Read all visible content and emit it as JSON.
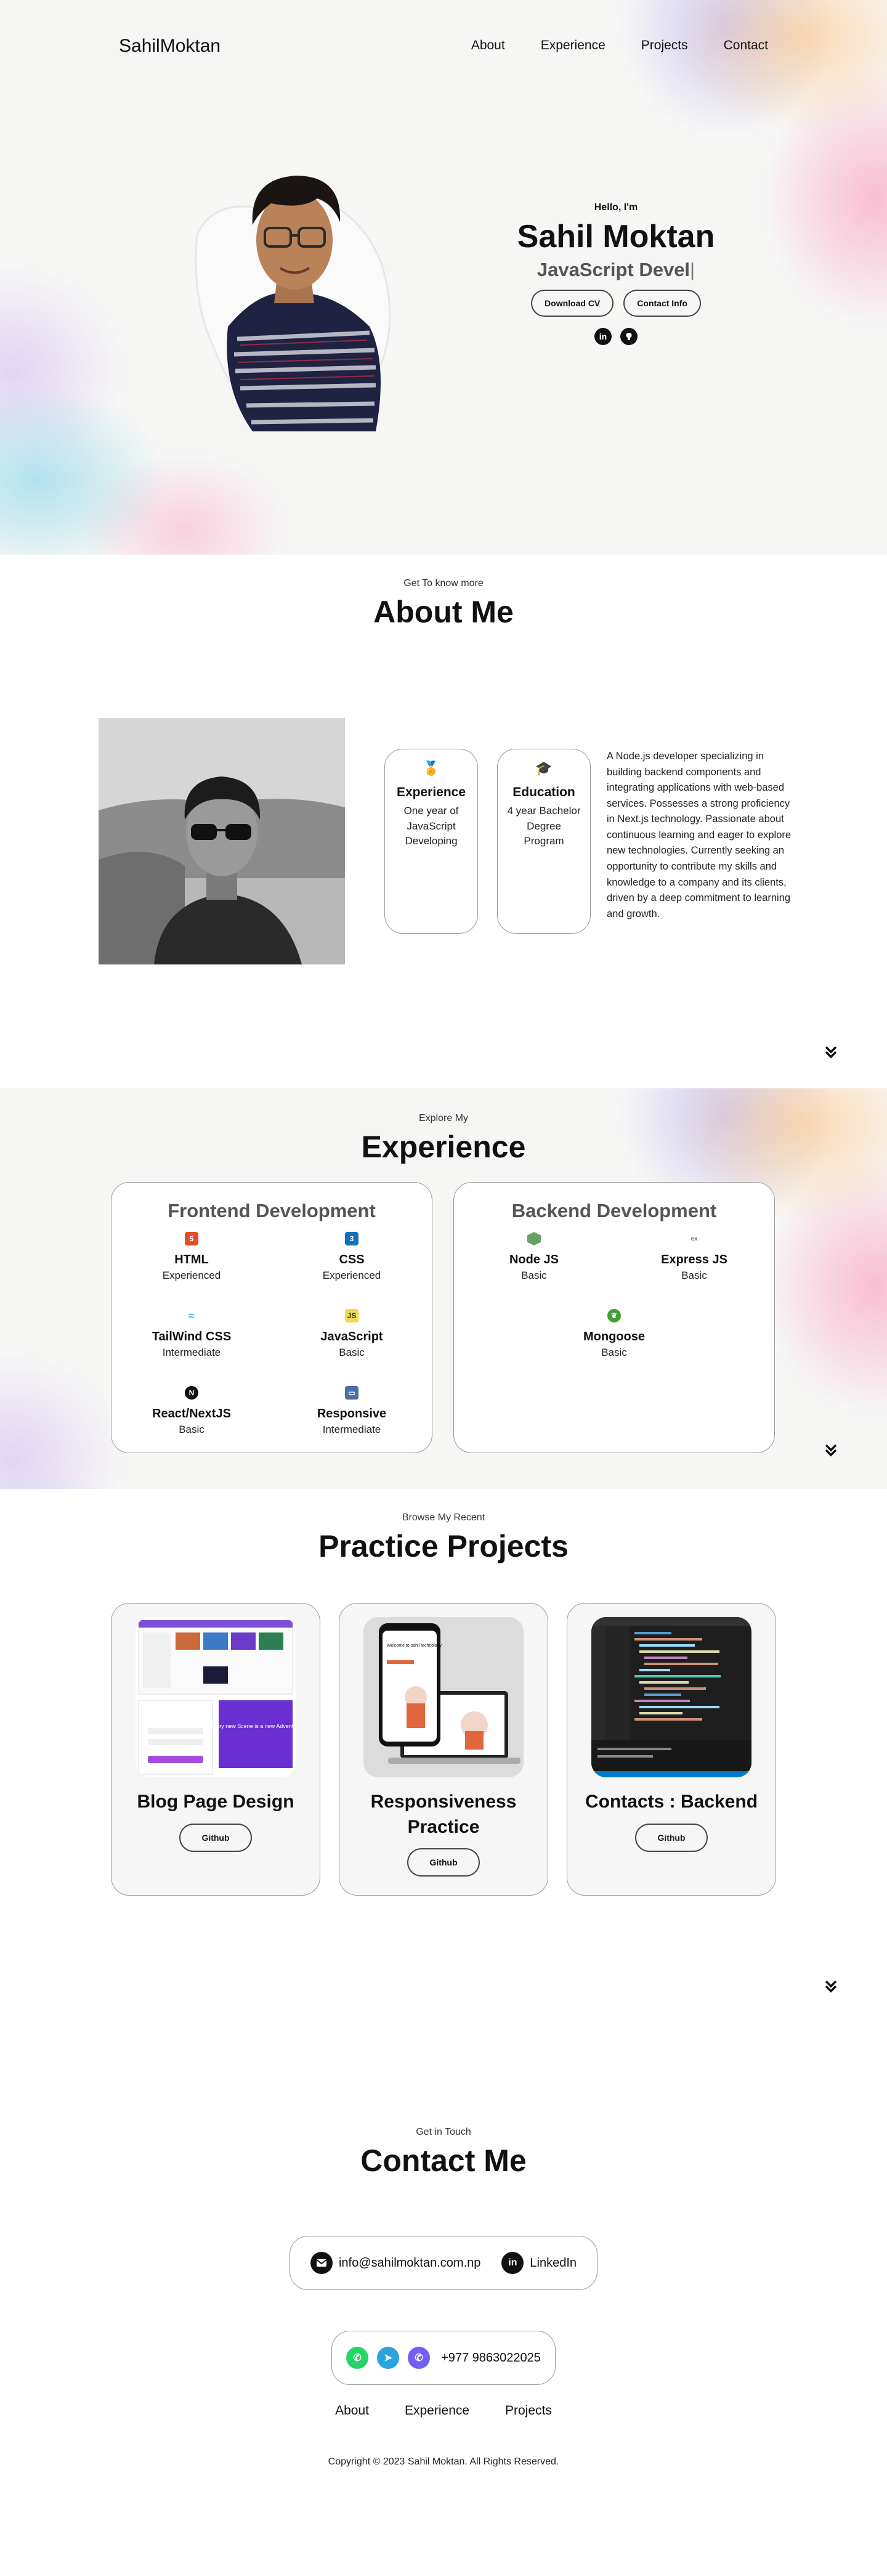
{
  "nav": {
    "logo": "SahilMoktan",
    "links": [
      "About",
      "Experience",
      "Projects",
      "Contact"
    ]
  },
  "hero": {
    "greeting": "Hello, I'm",
    "name": "Sahil Moktan",
    "role": "JavaScript Devel",
    "download_cv": "Download CV",
    "contact_info": "Contact Info",
    "socials": [
      "linkedin-icon",
      "github-icon"
    ]
  },
  "about": {
    "eyebrow": "Get To know more",
    "title": "About Me",
    "cards": [
      {
        "icon": "medal-icon",
        "title": "Experience",
        "text": "One year of JavaScript Developing"
      },
      {
        "icon": "graduation-icon",
        "title": "Education",
        "text": "4 year Bachelor Degree Program"
      }
    ],
    "description": "A Node.js developer specializing in building backend components and integrating applications with web-based services. Possesses a strong proficiency in Next.js technology. Passionate about continuous learning and eager to explore new technologies. Currently seeking an opportunity to contribute my skills and knowledge to a company and its clients, driven by a deep commitment to learning and growth."
  },
  "experience": {
    "eyebrow": "Explore My",
    "title": "Experience",
    "frontend": {
      "title": "Frontend Development",
      "skills": [
        {
          "name": "HTML",
          "level": "Experienced",
          "icon": "html5-icon",
          "color": "#e44d26"
        },
        {
          "name": "CSS",
          "level": "Experienced",
          "icon": "css3-icon",
          "color": "#1572b6"
        },
        {
          "name": "TailWind CSS",
          "level": "Intermediate",
          "icon": "tailwind-icon",
          "color": "#38bdf8"
        },
        {
          "name": "JavaScript",
          "level": "Basic",
          "icon": "javascript-icon",
          "color": "#f0db4f"
        },
        {
          "name": "React/NextJS",
          "level": "Basic",
          "icon": "nextjs-icon",
          "color": "#111111"
        },
        {
          "name": "Responsive",
          "level": "Intermediate",
          "icon": "responsive-icon",
          "color": "#4a6fa5"
        }
      ]
    },
    "backend": {
      "title": "Backend Development",
      "skills": [
        {
          "name": "Node JS",
          "level": "Basic",
          "icon": "nodejs-icon",
          "color": "#68a063"
        },
        {
          "name": "Express JS",
          "level": "Basic",
          "icon": "express-icon",
          "color": "#999999"
        },
        {
          "name": "Mongoose",
          "level": "Basic",
          "icon": "mongoose-icon",
          "color": "#3fa037"
        }
      ]
    }
  },
  "projects": {
    "eyebrow": "Browse My Recent",
    "title": "Practice Projects",
    "items": [
      {
        "title": "Blog Page Design",
        "button": "Github"
      },
      {
        "title": "Responsiveness Practice",
        "button": "Github"
      },
      {
        "title": "Contacts : Backend",
        "button": "Github"
      }
    ],
    "mock": {
      "welcome": "Welcome to sahil technology",
      "every_hero": "Every new Scene is a new Adventure"
    }
  },
  "contact": {
    "eyebrow": "Get in Touch",
    "title": "Contact Me",
    "email": "info@sahilmoktan.com.np",
    "linkedin": "LinkedIn",
    "phone": "+977 9863022025"
  },
  "footer": {
    "links": [
      "About",
      "Experience",
      "Projects"
    ],
    "copyright": "Copyright © 2023 Sahil Moktan. All Rights Reserved."
  }
}
